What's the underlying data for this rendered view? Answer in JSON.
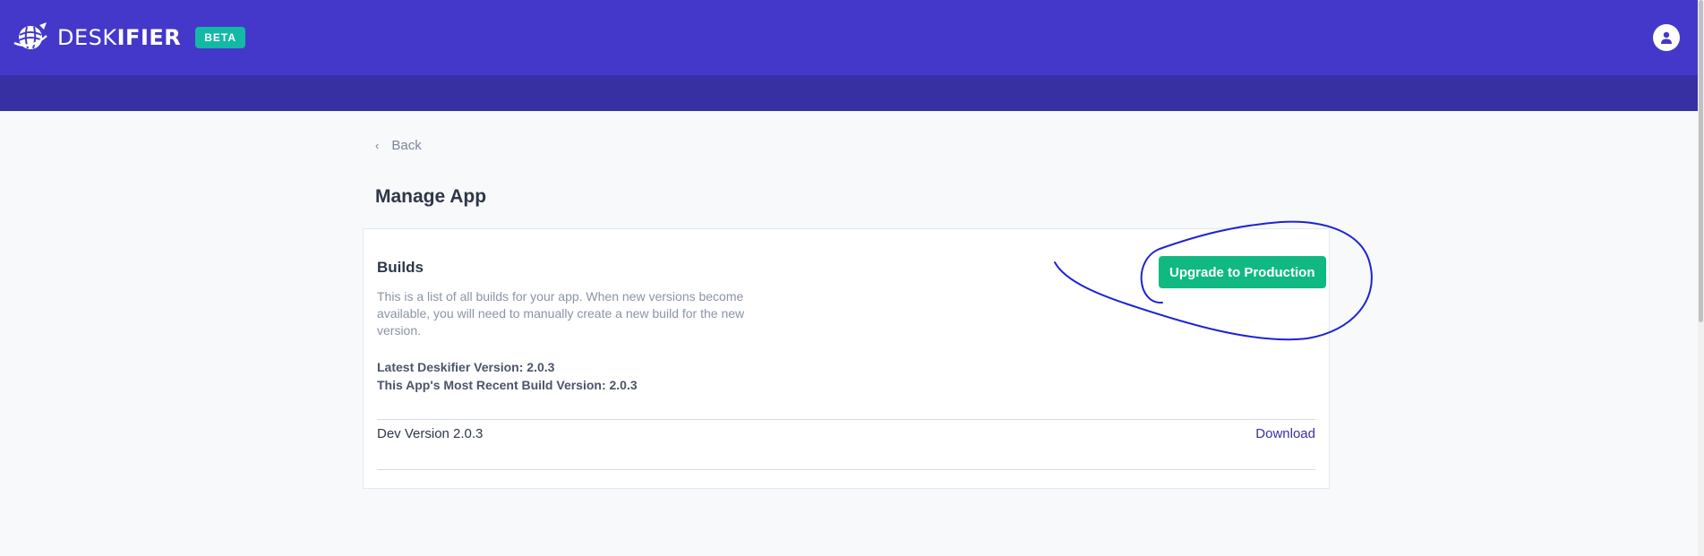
{
  "header": {
    "brand_light": "DESK",
    "brand_bold": "IFIER",
    "badge": "BETA",
    "logo_icon": "globe-plane-icon",
    "avatar_icon": "user-icon"
  },
  "nav": {
    "back_label": "Back",
    "back_icon": "chevron-left-icon"
  },
  "main": {
    "page_title": "Manage App",
    "builds": {
      "title": "Builds",
      "description": "This is a list of all builds for your app. When new versions become available, you will need to manually create a new build for the new version.",
      "latest_version": "Latest Deskifier Version: 2.0.3",
      "recent_build": "This App's Most Recent Build Version: 2.0.3",
      "upgrade_label": "Upgrade to Production",
      "items": [
        {
          "name": "Dev Version 2.0.3",
          "action": "Download"
        }
      ]
    }
  },
  "colors": {
    "header": "#4438ca",
    "subheader": "#3730a3",
    "badge": "#14b8a6",
    "primary_button": "#10b981",
    "link": "#3730a3",
    "annotation_ink": "#1d22d6"
  }
}
